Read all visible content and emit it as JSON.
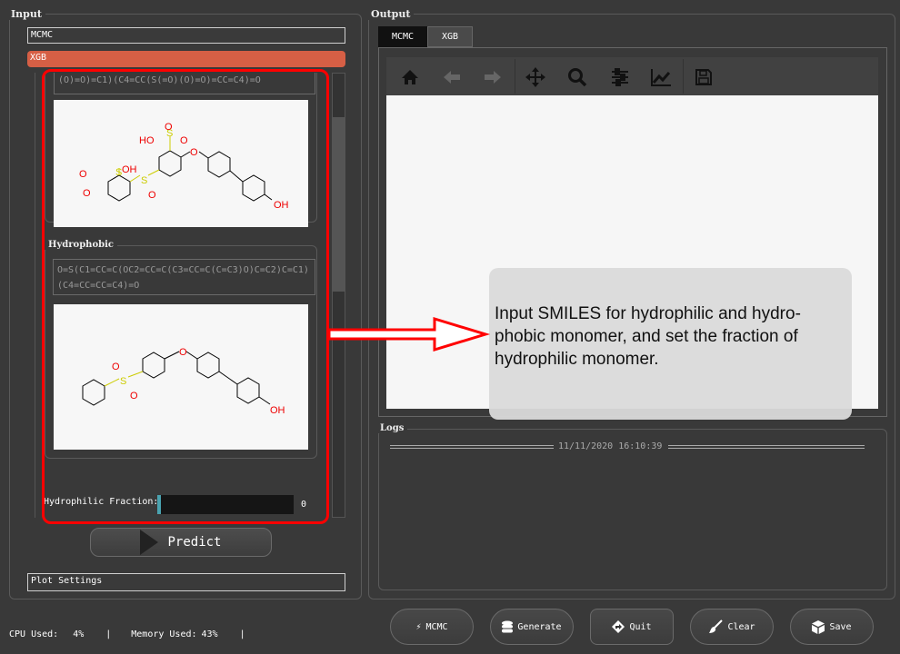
{
  "input": {
    "title": "Input",
    "mcmc_label": "MCMC",
    "xgb_label": "XGB",
    "hydrophilic_smiles": "(O)=O)=C1)(C4=CC(S(=O)(O)=O)=CC=C4)=O",
    "hydrophobic_title": "Hydrophobic",
    "hydrophobic_smiles": "O=S(C1=CC=C(OC2=CC=C(C3=CC=C(C=C3)O)C=C2)C=C1)(C4=CC=CC=C4)=O",
    "fraction_label": "Hydrophilic Fraction:",
    "fraction_value": "0",
    "fraction_level": 0,
    "predict_label": "Predict",
    "plot_settings_label": "Plot Settings",
    "atoms": {
      "oh": "OH",
      "ho": "HO",
      "o": "O",
      "s": "S"
    }
  },
  "output": {
    "title": "Output",
    "tabs": [
      {
        "label": "MCMC",
        "active": true
      },
      {
        "label": "XGB",
        "active": false
      }
    ],
    "toolbar": [
      "home-icon",
      "back-icon",
      "forward-icon",
      "pan-icon",
      "zoom-icon",
      "configure-icon",
      "edit-curves-icon",
      "save-icon"
    ],
    "callout": "Input SMILES for hydrophilic and hydro-phobic monomer, and set the fraction of hydrophilic monomer."
  },
  "logs": {
    "title": "Logs",
    "timestamp": "11/11/2020 16:10:39"
  },
  "buttons": [
    {
      "label": "MCMC",
      "icon": "lightning-icon"
    },
    {
      "label": "Generate",
      "icon": "database-icon"
    },
    {
      "label": "Quit",
      "icon": "diamond-arrow-icon"
    },
    {
      "label": "Clear",
      "icon": "brush-icon"
    },
    {
      "label": "Save",
      "icon": "cube-icon"
    }
  ],
  "status": {
    "cpu_label": "CPU Used:",
    "cpu_value": "4%",
    "mem_label": "Memory Used:",
    "mem_value": "43%",
    "sep": "|"
  },
  "colors": {
    "accent": "#d65f45",
    "highlight": "#ff0000",
    "slider": "#4aa3b0"
  }
}
